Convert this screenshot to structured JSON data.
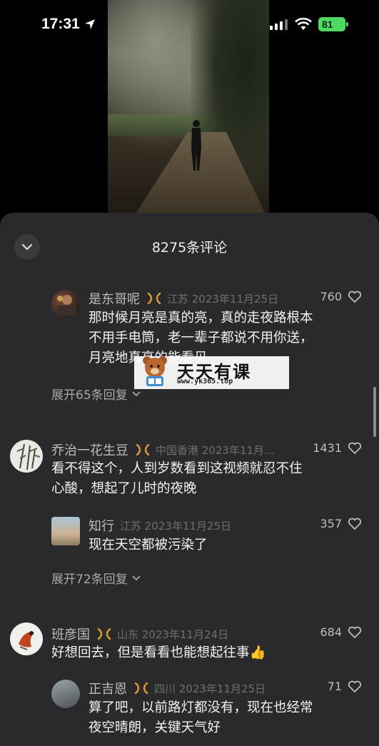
{
  "status_bar": {
    "time": "17:31",
    "battery": "81"
  },
  "comments_panel": {
    "title": "8275条评论",
    "comments": [
      {
        "username": "是东哥呢",
        "meta": "江苏 2023年11月25日",
        "likes": "760",
        "text_lines": [
          "那时候月亮是真的亮，真的走夜路根本",
          "不用手电筒，老一辈子都说不用你送，",
          "月亮地真亮的能看见"
        ],
        "expand": "展开65条回复"
      },
      {
        "username": "乔治一花生豆",
        "meta": "中国香港 2023年11月...",
        "likes": "1431",
        "text_lines": [
          "看不得这个，人到岁数看到这视频就忍不住",
          "心酸，想起了儿时的夜晚"
        ],
        "reply": {
          "username": "知行",
          "meta": "江苏 2023年11月25日",
          "likes": "357",
          "text": "现在天空都被污染了"
        },
        "expand": "展开72条回复"
      },
      {
        "username": "班彦国",
        "meta": "山东 2023年11月24日",
        "likes": "684",
        "text": "好想回去，但是看看也能想起往事👍",
        "reply": {
          "username": "正吉恩",
          "meta": "四川 2023年11月25日",
          "likes": "71",
          "text_lines": [
            "算了吧，以前路灯都没有，现在也经常",
            "夜空晴朗，关键天气好"
          ]
        }
      }
    ]
  },
  "watermark": {
    "title": "天天有课",
    "url": "www.yk365.top"
  },
  "colors": {
    "panel_bg": "#2a2a2c",
    "badge_orange": "#e0a030",
    "battery_green": "#4cd964"
  }
}
